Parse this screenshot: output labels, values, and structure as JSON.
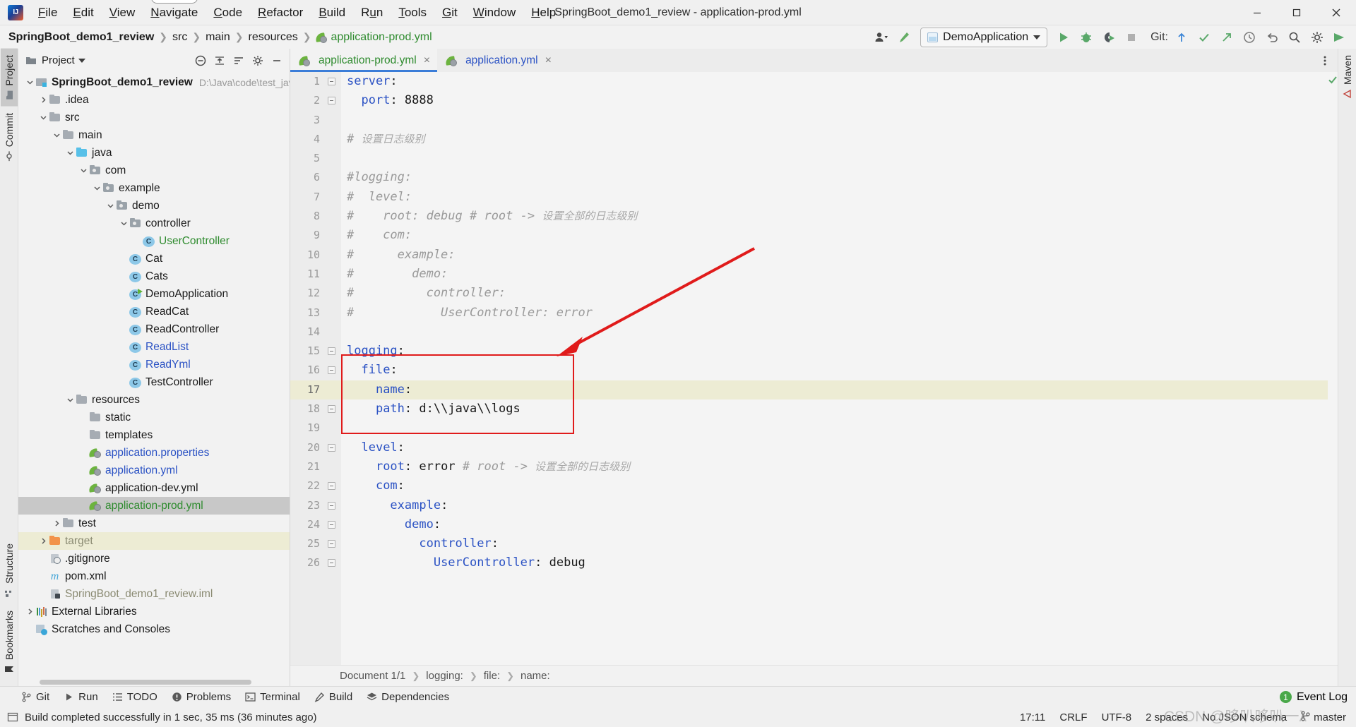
{
  "window": {
    "title": "SpringBoot_demo1_review - application-prod.yml",
    "minimize": "minimize-icon",
    "maximize": "maximize-icon",
    "close": "close-icon"
  },
  "menubar": {
    "items": [
      {
        "label": "File",
        "mnemonic": "F"
      },
      {
        "label": "Edit",
        "mnemonic": "E"
      },
      {
        "label": "View",
        "mnemonic": "V"
      },
      {
        "label": "Navigate",
        "mnemonic": "N"
      },
      {
        "label": "Code",
        "mnemonic": "C"
      },
      {
        "label": "Refactor",
        "mnemonic": "R"
      },
      {
        "label": "Build",
        "mnemonic": "B"
      },
      {
        "label": "Run",
        "mnemonic": "u"
      },
      {
        "label": "Tools",
        "mnemonic": "T"
      },
      {
        "label": "Git",
        "mnemonic": "G"
      },
      {
        "label": "Window",
        "mnemonic": "W"
      },
      {
        "label": "Help",
        "mnemonic": "H"
      }
    ],
    "active": "Navigate"
  },
  "navbar": {
    "crumbs": [
      "SpringBoot_demo1_review",
      "src",
      "main",
      "resources",
      "application-prod.yml"
    ],
    "run_config": "DemoApplication",
    "git_label": "Git:",
    "icons": {
      "profiler": "user-profile-icon",
      "build": "hammer-icon",
      "run": "run-icon",
      "debug": "debug-icon",
      "run_coverage": "run-with-coverage-icon",
      "stop": "stop-icon",
      "update_project": "update-project-icon",
      "commit": "commit-checkmark-icon",
      "push": "push-arrow-icon",
      "history": "history-clock-icon",
      "undo": "undo-icon",
      "search": "search-everywhere-icon",
      "settings": "settings-gear-icon",
      "codewith": "code-with-me-icon"
    }
  },
  "left_strip": {
    "tabs": [
      {
        "label": "Project",
        "icon": "project-folder-icon",
        "selected": true
      },
      {
        "label": "Commit",
        "icon": "commit-icon",
        "selected": false
      }
    ],
    "bottom_tabs": [
      {
        "label": "Structure",
        "icon": "structure-icon"
      },
      {
        "label": "Bookmarks",
        "icon": "bookmark-icon"
      }
    ]
  },
  "right_strip": {
    "tabs": [
      {
        "label": "Maven",
        "icon": "maven-icon"
      }
    ]
  },
  "project_panel": {
    "title": "Project",
    "tools": [
      "collapse-all-icon",
      "expand-icon",
      "sort-icon",
      "settings-gear-icon",
      "hide-icon"
    ],
    "tree": [
      {
        "label": "SpringBoot_demo1_review",
        "sub": "D:\\Java\\code\\test_java\\SpringB",
        "indent": 0,
        "arrow": "down",
        "icon": "project-icon",
        "color": "default",
        "bold": true
      },
      {
        "label": ".idea",
        "indent": 1,
        "arrow": "right",
        "icon": "folder-icon",
        "color": "default"
      },
      {
        "label": "src",
        "indent": 1,
        "arrow": "down",
        "icon": "folder-icon",
        "color": "default"
      },
      {
        "label": "main",
        "indent": 2,
        "arrow": "down",
        "icon": "folder-icon",
        "color": "default"
      },
      {
        "label": "java",
        "indent": 3,
        "arrow": "down",
        "icon": "source-folder-icon",
        "color": "default"
      },
      {
        "label": "com",
        "indent": 4,
        "arrow": "down",
        "icon": "package-icon",
        "color": "default"
      },
      {
        "label": "example",
        "indent": 5,
        "arrow": "down",
        "icon": "package-icon",
        "color": "default"
      },
      {
        "label": "demo",
        "indent": 6,
        "arrow": "down",
        "icon": "package-icon",
        "color": "default"
      },
      {
        "label": "controller",
        "indent": 7,
        "arrow": "down",
        "icon": "package-icon",
        "color": "default"
      },
      {
        "label": "UserController",
        "indent": 8,
        "arrow": "none",
        "icon": "java-class-icon",
        "color": "green"
      },
      {
        "label": "Cat",
        "indent": 7,
        "arrow": "none",
        "icon": "java-class-icon",
        "color": "default"
      },
      {
        "label": "Cats",
        "indent": 7,
        "arrow": "none",
        "icon": "java-class-icon",
        "color": "default"
      },
      {
        "label": "DemoApplication",
        "indent": 7,
        "arrow": "none",
        "icon": "java-runnable-class-icon",
        "color": "default"
      },
      {
        "label": "ReadCat",
        "indent": 7,
        "arrow": "none",
        "icon": "java-class-icon",
        "color": "default"
      },
      {
        "label": "ReadController",
        "indent": 7,
        "arrow": "none",
        "icon": "java-class-icon",
        "color": "default"
      },
      {
        "label": "ReadList",
        "indent": 7,
        "arrow": "none",
        "icon": "java-class-icon",
        "color": "blue"
      },
      {
        "label": "ReadYml",
        "indent": 7,
        "arrow": "none",
        "icon": "java-class-icon",
        "color": "blue"
      },
      {
        "label": "TestController",
        "indent": 7,
        "arrow": "none",
        "icon": "java-class-icon",
        "color": "default"
      },
      {
        "label": "resources",
        "indent": 3,
        "arrow": "down",
        "icon": "resource-folder-icon",
        "color": "default"
      },
      {
        "label": "static",
        "indent": 4,
        "arrow": "none",
        "icon": "folder-icon",
        "color": "default"
      },
      {
        "label": "templates",
        "indent": 4,
        "arrow": "none",
        "icon": "folder-icon",
        "color": "default"
      },
      {
        "label": "application.properties",
        "indent": 4,
        "arrow": "none",
        "icon": "spring-file-icon",
        "color": "blue"
      },
      {
        "label": "application.yml",
        "indent": 4,
        "arrow": "none",
        "icon": "spring-file-icon",
        "color": "blue"
      },
      {
        "label": "application-dev.yml",
        "indent": 4,
        "arrow": "none",
        "icon": "spring-file-icon",
        "color": "default"
      },
      {
        "label": "application-prod.yml",
        "indent": 4,
        "arrow": "none",
        "icon": "spring-file-icon",
        "color": "green",
        "selected": true
      },
      {
        "label": "test",
        "indent": 2,
        "arrow": "right",
        "icon": "folder-icon",
        "color": "default"
      },
      {
        "label": "target",
        "indent": 1,
        "arrow": "right",
        "icon": "target-folder-icon",
        "color": "grey",
        "highlight": true
      },
      {
        "label": ".gitignore",
        "indent": 1,
        "arrow": "none",
        "icon": "gitignore-file-icon",
        "color": "default"
      },
      {
        "label": "pom.xml",
        "indent": 1,
        "arrow": "none",
        "icon": "maven-pom-icon",
        "color": "default"
      },
      {
        "label": "SpringBoot_demo1_review.iml",
        "indent": 1,
        "arrow": "none",
        "icon": "iml-file-icon",
        "color": "grey"
      },
      {
        "label": "External Libraries",
        "indent": 0,
        "arrow": "right",
        "icon": "libraries-icon",
        "color": "default"
      },
      {
        "label": "Scratches and Consoles",
        "indent": 0,
        "arrow": "none",
        "icon": "scratches-icon",
        "color": "default"
      }
    ]
  },
  "editor": {
    "tabs": [
      {
        "label": "application-prod.yml",
        "icon": "spring-file-icon",
        "active": true,
        "close": "×"
      },
      {
        "label": "application.yml",
        "icon": "spring-file-icon",
        "active": false,
        "close": "×"
      }
    ],
    "inspection_status": "ok-checkmark-icon",
    "lines": [
      {
        "n": 1,
        "fold": "start",
        "segments": [
          {
            "t": "server",
            "c": "k"
          },
          {
            "t": ":",
            "c": "v"
          }
        ]
      },
      {
        "n": 2,
        "fold": "end",
        "segments": [
          {
            "t": "  ",
            "c": "v"
          },
          {
            "t": "port",
            "c": "k"
          },
          {
            "t": ": ",
            "c": "v"
          },
          {
            "t": "8888",
            "c": "v"
          }
        ]
      },
      {
        "n": 3,
        "segments": []
      },
      {
        "n": 4,
        "segments": [
          {
            "t": "# ",
            "c": "cm"
          },
          {
            "t": "设置日志级别",
            "c": "cmz"
          }
        ]
      },
      {
        "n": 5,
        "segments": []
      },
      {
        "n": 6,
        "segments": [
          {
            "t": "#logging:",
            "c": "cm"
          }
        ]
      },
      {
        "n": 7,
        "segments": [
          {
            "t": "#  level:",
            "c": "cm"
          }
        ]
      },
      {
        "n": 8,
        "segments": [
          {
            "t": "#    root: debug # root -> ",
            "c": "cm"
          },
          {
            "t": "设置全部的日志级别",
            "c": "cmz"
          }
        ]
      },
      {
        "n": 9,
        "segments": [
          {
            "t": "#    com:",
            "c": "cm"
          }
        ]
      },
      {
        "n": 10,
        "segments": [
          {
            "t": "#      example:",
            "c": "cm"
          }
        ]
      },
      {
        "n": 11,
        "segments": [
          {
            "t": "#        demo:",
            "c": "cm"
          }
        ]
      },
      {
        "n": 12,
        "segments": [
          {
            "t": "#          controller:",
            "c": "cm"
          }
        ]
      },
      {
        "n": 13,
        "segments": [
          {
            "t": "#            UserController: error",
            "c": "cm"
          }
        ]
      },
      {
        "n": 14,
        "segments": []
      },
      {
        "n": 15,
        "fold": "start",
        "segments": [
          {
            "t": "logging",
            "c": "k"
          },
          {
            "t": ":",
            "c": "v"
          }
        ]
      },
      {
        "n": 16,
        "fold": "start",
        "segments": [
          {
            "t": "  ",
            "c": "v"
          },
          {
            "t": "file",
            "c": "k"
          },
          {
            "t": ":",
            "c": "v"
          }
        ]
      },
      {
        "n": 17,
        "current": true,
        "segments": [
          {
            "t": "    ",
            "c": "v"
          },
          {
            "t": "name",
            "c": "k"
          },
          {
            "t": ":",
            "c": "v"
          }
        ]
      },
      {
        "n": 18,
        "fold": "end",
        "segments": [
          {
            "t": "    ",
            "c": "v"
          },
          {
            "t": "path",
            "c": "k"
          },
          {
            "t": ": ",
            "c": "v"
          },
          {
            "t": "d:\\\\java\\\\logs",
            "c": "v"
          }
        ]
      },
      {
        "n": 19,
        "segments": []
      },
      {
        "n": 20,
        "fold": "start",
        "segments": [
          {
            "t": "  ",
            "c": "v"
          },
          {
            "t": "level",
            "c": "k"
          },
          {
            "t": ":",
            "c": "v"
          }
        ]
      },
      {
        "n": 21,
        "segments": [
          {
            "t": "    ",
            "c": "v"
          },
          {
            "t": "root",
            "c": "k"
          },
          {
            "t": ": ",
            "c": "v"
          },
          {
            "t": "error",
            "c": "v"
          },
          {
            "t": " # root -> ",
            "c": "cm"
          },
          {
            "t": "设置全部的日志级别",
            "c": "cmz"
          }
        ]
      },
      {
        "n": 22,
        "fold": "start",
        "segments": [
          {
            "t": "    ",
            "c": "v"
          },
          {
            "t": "com",
            "c": "k"
          },
          {
            "t": ":",
            "c": "v"
          }
        ]
      },
      {
        "n": 23,
        "fold": "start",
        "segments": [
          {
            "t": "      ",
            "c": "v"
          },
          {
            "t": "example",
            "c": "k"
          },
          {
            "t": ":",
            "c": "v"
          }
        ]
      },
      {
        "n": 24,
        "fold": "start",
        "segments": [
          {
            "t": "        ",
            "c": "v"
          },
          {
            "t": "demo",
            "c": "k"
          },
          {
            "t": ":",
            "c": "v"
          }
        ]
      },
      {
        "n": 25,
        "fold": "start",
        "segments": [
          {
            "t": "          ",
            "c": "v"
          },
          {
            "t": "controller",
            "c": "k"
          },
          {
            "t": ":",
            "c": "v"
          }
        ]
      },
      {
        "n": 26,
        "fold": "end",
        "segments": [
          {
            "t": "            ",
            "c": "v"
          },
          {
            "t": "UserController",
            "c": "k"
          },
          {
            "t": ": ",
            "c": "v"
          },
          {
            "t": "debug",
            "c": "v"
          }
        ]
      }
    ],
    "annotation": {
      "box_color": "#e01b1b",
      "arrow_color": "#e01b1b"
    },
    "breadcrumb": [
      "Document 1/1",
      "logging:",
      "file:",
      "name:"
    ]
  },
  "toolwindow_bar": {
    "items": [
      {
        "label": "Git",
        "icon": "git-branch-icon"
      },
      {
        "label": "Run",
        "icon": "run-icon"
      },
      {
        "label": "TODO",
        "icon": "todo-list-icon"
      },
      {
        "label": "Problems",
        "icon": "problems-icon"
      },
      {
        "label": "Terminal",
        "icon": "terminal-icon"
      },
      {
        "label": "Build",
        "icon": "build-hammer-icon"
      },
      {
        "label": "Dependencies",
        "icon": "dependencies-icon"
      }
    ],
    "event_log": {
      "label": "Event Log",
      "count": "1"
    }
  },
  "statusbar": {
    "message": "Build completed successfully in 1 sec, 35 ms (36 minutes ago)",
    "message_icon": "build-window-icon",
    "caret_position": "17:11",
    "line_separator": "CRLF",
    "encoding": "UTF-8",
    "indent": "2 spaces",
    "schema": "No JSON schema",
    "branch": "master",
    "branch_icon": "git-branch-icon"
  },
  "watermark": "CSDN @哆叭哆叭一λ"
}
